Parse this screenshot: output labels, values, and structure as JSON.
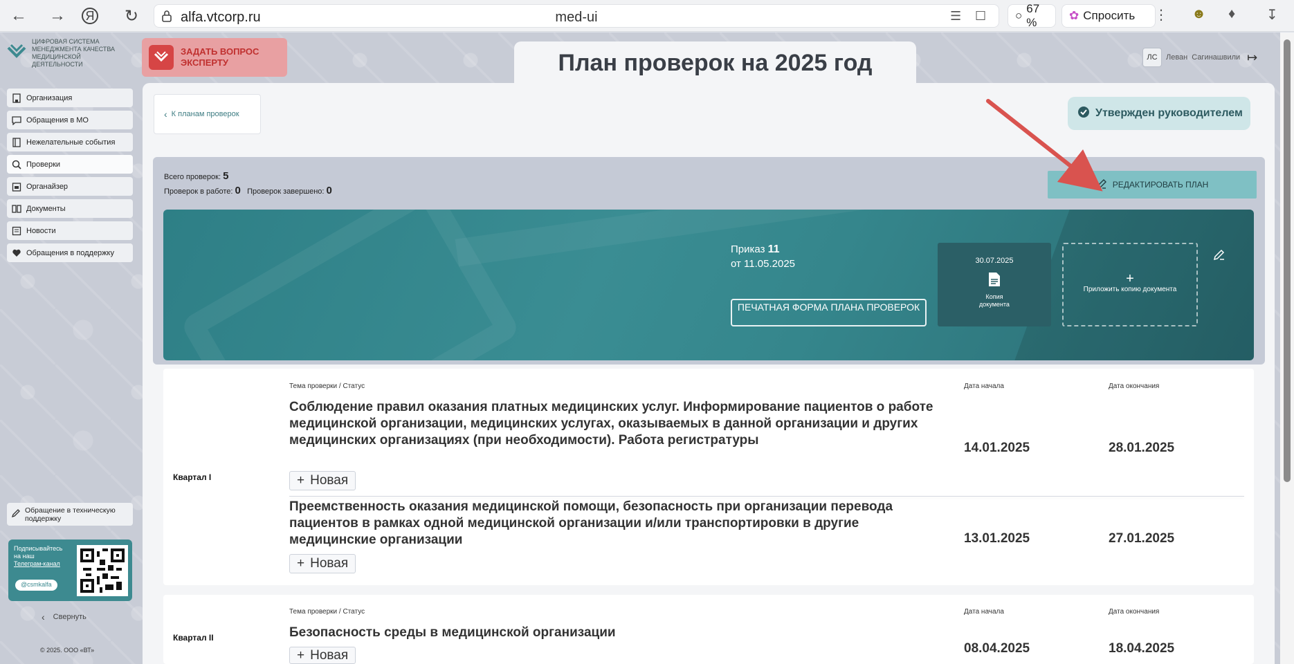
{
  "browser": {
    "url": "alfa.vtcorp.ru",
    "page_title": "med-ui",
    "zoom": "67 %",
    "ask_label": "Спросить"
  },
  "sidebar": {
    "logo_text": "ЦИФРОВАЯ СИСТЕМА МЕНЕДЖМЕНТА КАЧЕСТВА МЕДИЦИНСКОЙ ДЕЯТЕЛЬНОСТИ",
    "items": [
      {
        "label": "Организация",
        "icon": "building-icon"
      },
      {
        "label": "Обращения в МО",
        "icon": "chat-icon"
      },
      {
        "label": "Нежелательные события",
        "icon": "book-icon"
      },
      {
        "label": "Проверки",
        "icon": "search-icon"
      },
      {
        "label": "Органайзер",
        "icon": "calendar-icon"
      },
      {
        "label": "Документы",
        "icon": "documents-icon"
      },
      {
        "label": "Новости",
        "icon": "news-icon"
      },
      {
        "label": "Обращения в поддержку",
        "icon": "heart-icon"
      }
    ],
    "support_label": "Обращение в техническую поддержку",
    "telegram": {
      "line1": "Подписывайтесь на наш",
      "link": "Телеграм-канал",
      "handle": "@csmkalfa"
    },
    "collapse_label": "Свернуть",
    "copyright": "© 2025. ООО «ВТ»"
  },
  "header": {
    "ask_expert": "ЗАДАТЬ ВОПРОС ЭКСПЕРТУ",
    "title": "План проверок на 2025 год",
    "user_initials": "ЛС",
    "user_first": "Леван",
    "user_last": "Сагинашвили"
  },
  "main": {
    "back_label": "К планам проверок",
    "approved_label": "Утвержден руководителем",
    "stats": {
      "total_label": "Всего проверок:",
      "total_value": "5",
      "in_work_label": "Проверок в работе:",
      "in_work_value": "0",
      "done_label": "Проверок завершено:",
      "done_value": "0"
    },
    "edit_plan_label": "РЕДАКТИРОВАТЬ ПЛАН",
    "order": {
      "prefix": "Приказ",
      "number": "11",
      "date_line": "от 11.05.2025"
    },
    "print_label": "ПЕЧАТНАЯ ФОРМА ПЛАНА ПРОВЕРОК",
    "copy_card": {
      "date": "30.07.2025",
      "label": "Копия документа"
    },
    "attach_label": "Приложить копию документа"
  },
  "table": {
    "col_topic": "Тема проверки / Статус",
    "col_start": "Дата начала",
    "col_end": "Дата окончания",
    "quarters": [
      {
        "label": "Квартал I",
        "rows": [
          {
            "topic": "Соблюдение правил оказания платных медицинских услуг. Информирование пациентов о работе медицинской организации, медицинских услугах, оказываемых в данной организации и других медицинских организациях (при необходимости). Работа регистратуры",
            "status": "Новая",
            "start": "14.01.2025",
            "end": "28.01.2025"
          },
          {
            "topic": "Преемственность оказания медицинской помощи, безопасность при организации перевода пациентов в рамках одной медицинской организации и/или транспортировки в другие медицинские организации",
            "status": "Новая",
            "start": "13.01.2025",
            "end": "27.01.2025"
          }
        ]
      },
      {
        "label": "Квартал II",
        "rows": [
          {
            "topic": "Безопасность среды в медицинской организации",
            "status": "Новая",
            "start": "08.04.2025",
            "end": "18.04.2025"
          }
        ]
      }
    ]
  },
  "colors": {
    "accent_teal": "#3a8d93",
    "approved_bg": "#cfe6e8",
    "edit_btn": "#7fc0c4",
    "ask_bg": "#e8a0a2",
    "arrow": "#d9534f"
  }
}
